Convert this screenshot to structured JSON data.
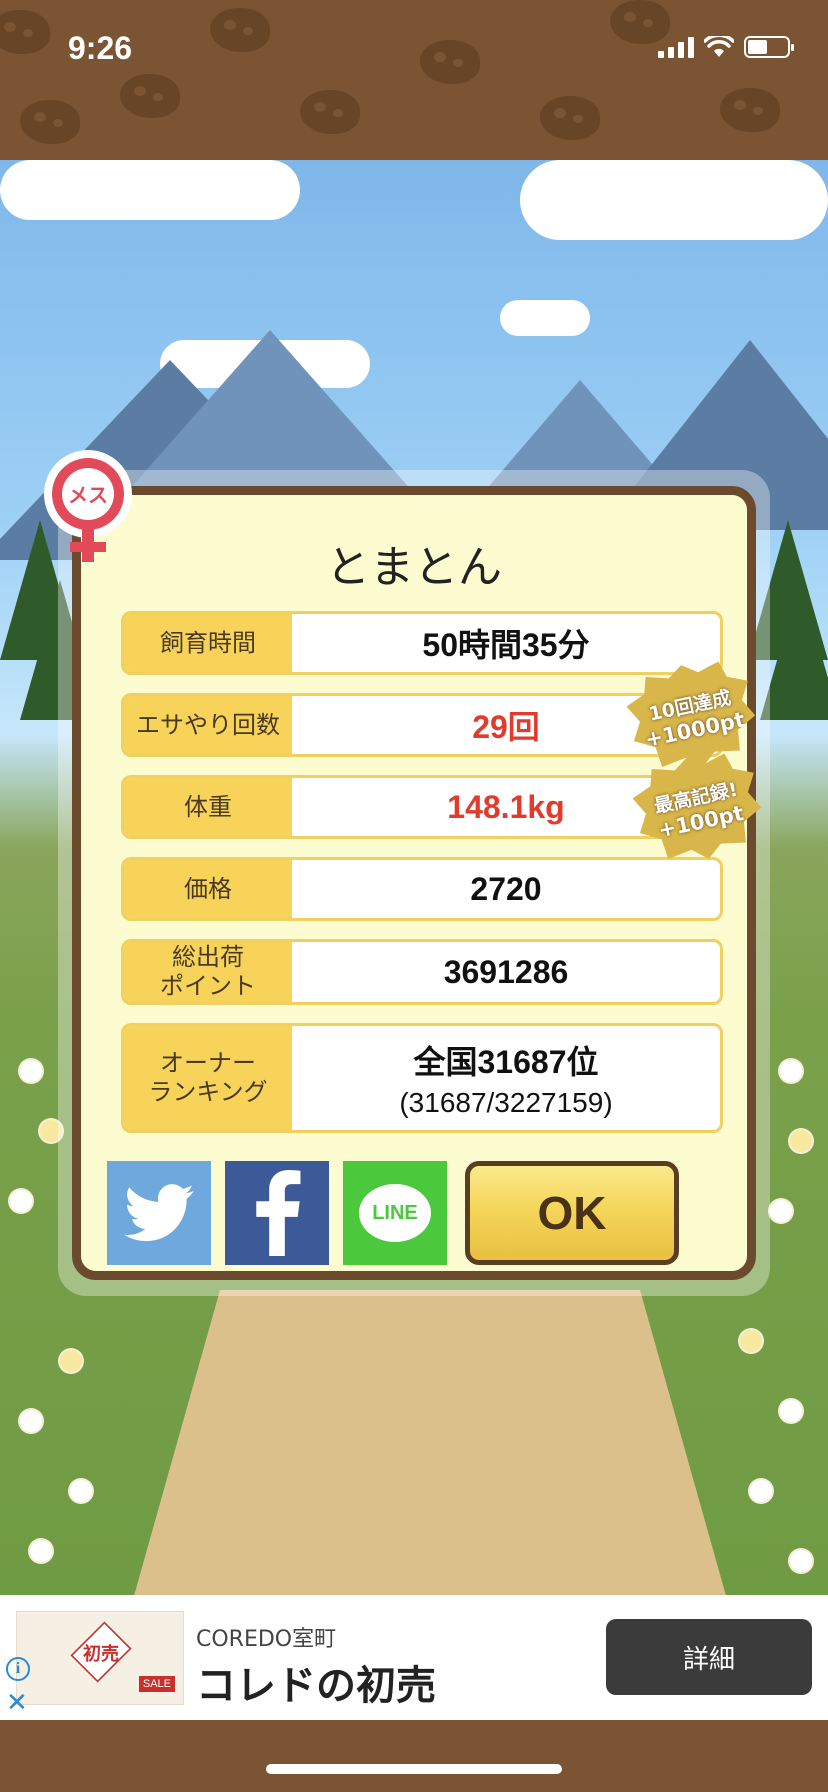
{
  "status": {
    "time": "9:26"
  },
  "dialog": {
    "pet_name": "とまとん",
    "gender_label": "メス",
    "rows": [
      {
        "label": "飼育時間",
        "value": "50時間35分"
      },
      {
        "label": "エサやり回数",
        "value": "29回"
      },
      {
        "label": "体重",
        "value": "148.1kg"
      },
      {
        "label": "価格",
        "value": "2720"
      },
      {
        "label": "総出荷\nポイント",
        "value": "3691286"
      },
      {
        "label": "オーナー\nランキング",
        "value": "全国31687位",
        "sub": "(31687/3227159)"
      }
    ],
    "badges": [
      {
        "line1": "10回達成",
        "line2": "+1000pt"
      },
      {
        "line1": "最高記録!",
        "line2": "+100pt"
      }
    ],
    "share": {
      "twitter": "twitter-icon",
      "facebook": "facebook-icon",
      "line": "LINE"
    },
    "ok_label": "OK"
  },
  "ad": {
    "image_text": "初売",
    "image_sale": "SALE",
    "sponsor": "COREDO室町",
    "title": "コレドの初売",
    "button": "詳細"
  },
  "colors": {
    "accent_yellow": "#f7d35a",
    "frame_brown": "#6b4a2e",
    "highlight_red": "#e23a2c"
  }
}
